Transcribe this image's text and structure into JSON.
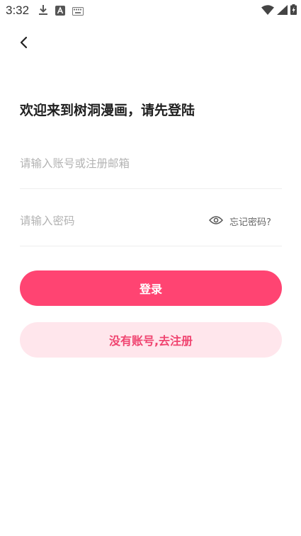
{
  "status_bar": {
    "time": "3:32",
    "left_icons": [
      "download-icon",
      "a-notification-icon",
      "keyboard-icon"
    ],
    "right_icons": [
      "wifi-icon",
      "signal-icon",
      "battery-charging-icon"
    ]
  },
  "header": {
    "back_icon": "chevron-left-icon"
  },
  "title": "欢迎来到树洞漫画，请先登陆",
  "form": {
    "account_placeholder": "请输入账号或注册邮箱",
    "password_placeholder": "请输入密码",
    "password_toggle_icon": "eye-icon",
    "forgot_password": "忘记密码?"
  },
  "buttons": {
    "login": "登录",
    "register": "没有账号,去注册"
  },
  "colors": {
    "primary": "#ff4472",
    "secondary_bg": "#ffe6ec",
    "secondary_text": "#f04470"
  }
}
